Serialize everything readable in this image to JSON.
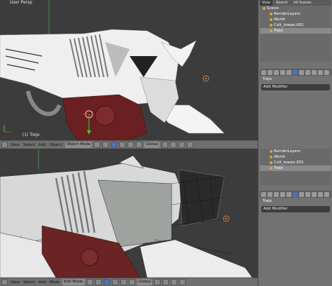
{
  "top": {
    "viewport_label": "User Persp",
    "object_label": "(1) Trejo",
    "header": {
      "view": "View",
      "select": "Select",
      "add": "Add",
      "object": "Object",
      "mode": "Object Mode",
      "pivot": "Global"
    },
    "outliner": {
      "tabs": [
        "View",
        "Search",
        "All Scenes"
      ],
      "rows": [
        "Scene",
        "RenderLayers",
        "World",
        "Colt_towpo.001",
        "Trejo"
      ]
    },
    "breadcrumb": "Trejo",
    "add_modifier": "Add Modifier"
  },
  "bottom": {
    "header": {
      "view": "View",
      "select": "Select",
      "add": "Add",
      "mesh": "Mesh",
      "mode": "Edit Mode",
      "pivot": "Global"
    },
    "outliner": {
      "rows": [
        "RenderLayers",
        "World",
        "Colt_towpo.001",
        "Trejo"
      ]
    },
    "breadcrumb": "Trejo",
    "add_modifier": "Add Modifier"
  }
}
